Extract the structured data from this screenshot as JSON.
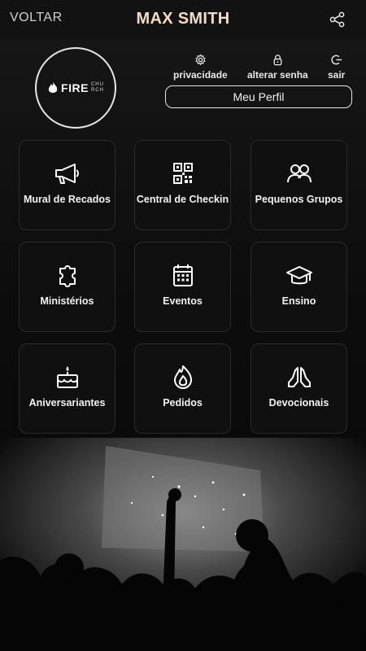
{
  "header": {
    "back_label": "VOLTAR",
    "title": "MAX SMITH",
    "share_icon": "share-icon"
  },
  "logo": {
    "word": "FIRE",
    "sub_line1": "CHU",
    "sub_line2": "RCH"
  },
  "quick_links": [
    {
      "label": "privacidade",
      "icon": "gear-icon"
    },
    {
      "label": "alterar senha",
      "icon": "lock-icon"
    },
    {
      "label": "sair",
      "icon": "logout-icon"
    }
  ],
  "profile_button": "Meu Perfil",
  "menu": [
    {
      "label": "Mural de Recados",
      "icon": "megaphone-icon"
    },
    {
      "label": "Central de Checkin",
      "icon": "qr-code-icon"
    },
    {
      "label": "Pequenos Grupos",
      "icon": "group-icon"
    },
    {
      "label": "Ministérios",
      "icon": "puzzle-icon"
    },
    {
      "label": "Eventos",
      "icon": "calendar-icon"
    },
    {
      "label": "Ensino",
      "icon": "graduation-cap-icon"
    },
    {
      "label": "Aniversariantes",
      "icon": "birthday-cake-icon"
    },
    {
      "label": "Pedidos",
      "icon": "flame-icon"
    },
    {
      "label": "Devocionais",
      "icon": "praying-hands-icon"
    }
  ],
  "colors": {
    "title": "#f0dcc4",
    "background": "#0c0c0c",
    "tile": "#101010"
  }
}
